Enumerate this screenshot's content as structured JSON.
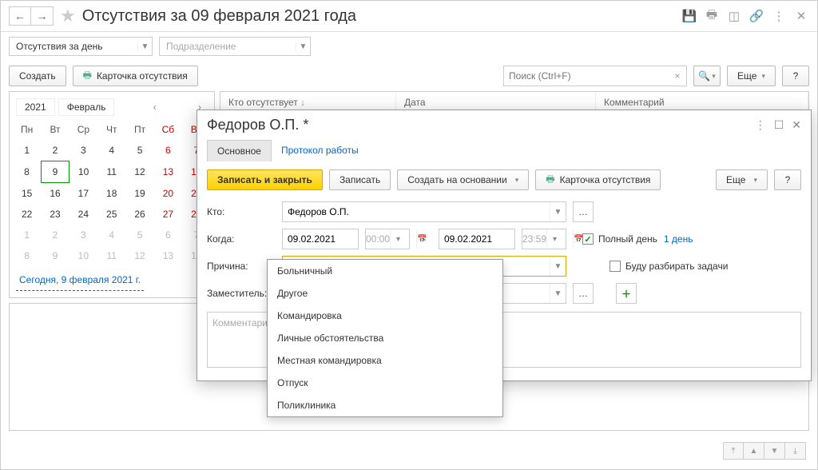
{
  "header": {
    "title": "Отсутствия за 09 февраля 2021 года"
  },
  "filter": {
    "view_label": "Отсутствия за день",
    "dept_placeholder": "Подразделение"
  },
  "actions": {
    "create": "Создать",
    "card": "Карточка отсутствия",
    "search_placeholder": "Поиск (Ctrl+F)",
    "more": "Еще"
  },
  "calendar": {
    "year": "2021",
    "month": "Февраль",
    "weekdays": [
      "Пн",
      "Вт",
      "Ср",
      "Чт",
      "Пт",
      "Сб",
      "Вс"
    ],
    "today_link": "Сегодня, 9 февраля 2021 г."
  },
  "table": {
    "cols": [
      "Кто отсутствует",
      "Дата",
      "Комментарий"
    ]
  },
  "modal": {
    "title": "Федоров О.П. *",
    "tabs": {
      "main": "Основное",
      "log": "Протокол работы"
    },
    "toolbar": {
      "save_close": "Записать и закрыть",
      "save": "Записать",
      "create_based": "Создать на основании",
      "card": "Карточка отсутствия",
      "more": "Еще"
    },
    "labels": {
      "who": "Кто:",
      "when": "Когда:",
      "reason": "Причина:",
      "deputy": "Заместитель:"
    },
    "fields": {
      "who": "Федоров О.П.",
      "date_from": "09.02.2021",
      "time_from": "00:00",
      "date_to": "09.02.2021",
      "time_to": "23:59",
      "full_day": "Полный день",
      "days": "1 день",
      "will_handle": "Буду разбирать задачи",
      "comment_placeholder": "Комментарий"
    },
    "reason_options": [
      "Больничный",
      "Другое",
      "Командировка",
      "Личные обстоятельства",
      "Местная командировка",
      "Отпуск",
      "Поликлиника"
    ]
  }
}
